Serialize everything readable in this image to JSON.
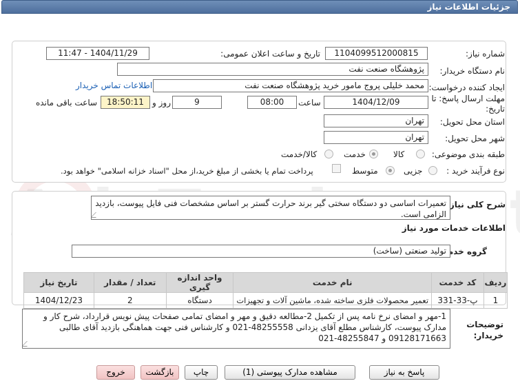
{
  "window": {
    "title": "جزئیات اطلاعات نیاز"
  },
  "watermark": {
    "text": "AriaTender.net"
  },
  "form": {
    "need_number": {
      "label": "شماره نیاز:",
      "value": "1104099512000815"
    },
    "announce_datetime": {
      "label": "تاریخ و ساعت اعلان عمومی:",
      "value": "1404/11/29 - 11:47"
    },
    "buyer_org": {
      "label": "نام دستگاه خریدار:",
      "value": "پژوهشگاه صنعت نفت"
    },
    "requester": {
      "label": "ایجاد کننده درخواست:",
      "value": "محمد خلیلی پروج مامور خرید پژوهشگاه صنعت نفت",
      "link": "اطلاعات تماس خریدار"
    },
    "deadline": {
      "label_line1": "مهلت ارسال پاسخ: تا",
      "label_line2": "تاریخ:",
      "date": "1404/12/09",
      "time_label": "ساعت",
      "time": "08:00",
      "days": "9",
      "days_label": "روز و",
      "remaining": "18:50:11",
      "remaining_label": "ساعت باقی مانده"
    },
    "province": {
      "label": "استان محل تحویل:",
      "value": "تهران"
    },
    "city": {
      "label": "شهر محل تحویل:",
      "value": "تهران"
    },
    "category": {
      "label": "طبقه بندی موضوعی:",
      "options": [
        "کالا",
        "خدمت",
        "کالا/خدمت"
      ],
      "selected": "خدمت"
    },
    "purchase_type": {
      "label": "نوع فرآیند خرید :",
      "options": [
        "جزیی",
        "متوسط"
      ],
      "selected": "متوسط",
      "treasury_note": "پرداخت تمام یا بخشی از مبلغ خرید،از محل \"اسناد خزانه اسلامی\" خواهد بود."
    }
  },
  "description": {
    "label": "شرح کلی نیاز:",
    "value": "تعمیرات اساسی دو دستگاه سختی گیر برند حرارت گستر بر اساس مشخصات فنی فایل پیوست، بازدید الزامی است."
  },
  "services": {
    "title": "اطلاعات خدمات مورد نیاز",
    "group_label": "گروه خدمت:",
    "group_value": "تولید صنعتی (ساخت)",
    "table": {
      "headers": [
        "ردیف",
        "کد خدمت",
        "نام خدمت",
        "واحد اندازه گیری",
        "تعداد / مقدار",
        "تاریخ نیاز"
      ],
      "rows": [
        [
          "1",
          "پ-33-331",
          "تعمیر محصولات فلزی ساخته شده، ماشین آلات و تجهیزات",
          "دستگاه",
          "2",
          "1404/12/23"
        ]
      ]
    }
  },
  "buyer_notes": {
    "label_line1": "توضیحات",
    "label_line2": "خریدار:",
    "value": "1-مهر و امضای نرخ نامه پس از تکمیل 2-مطالعه دقیق و مهر و امضای تمامی صفحات پیش نویس قرارداد، شرح کار و مدارک پیوست، کارشناس مطلع آقای یزدانی 48255558-021 و کارشناس فنی جهت هماهنگی بازدید آقای طالبی 09128171663 و 48255847-021"
  },
  "buttons": {
    "reply": "پاسخ به نیاز",
    "attachments": "مشاهده مدارک پیوستی (1)",
    "print": "چاپ",
    "back": "بازگشت",
    "exit": "خروج"
  }
}
